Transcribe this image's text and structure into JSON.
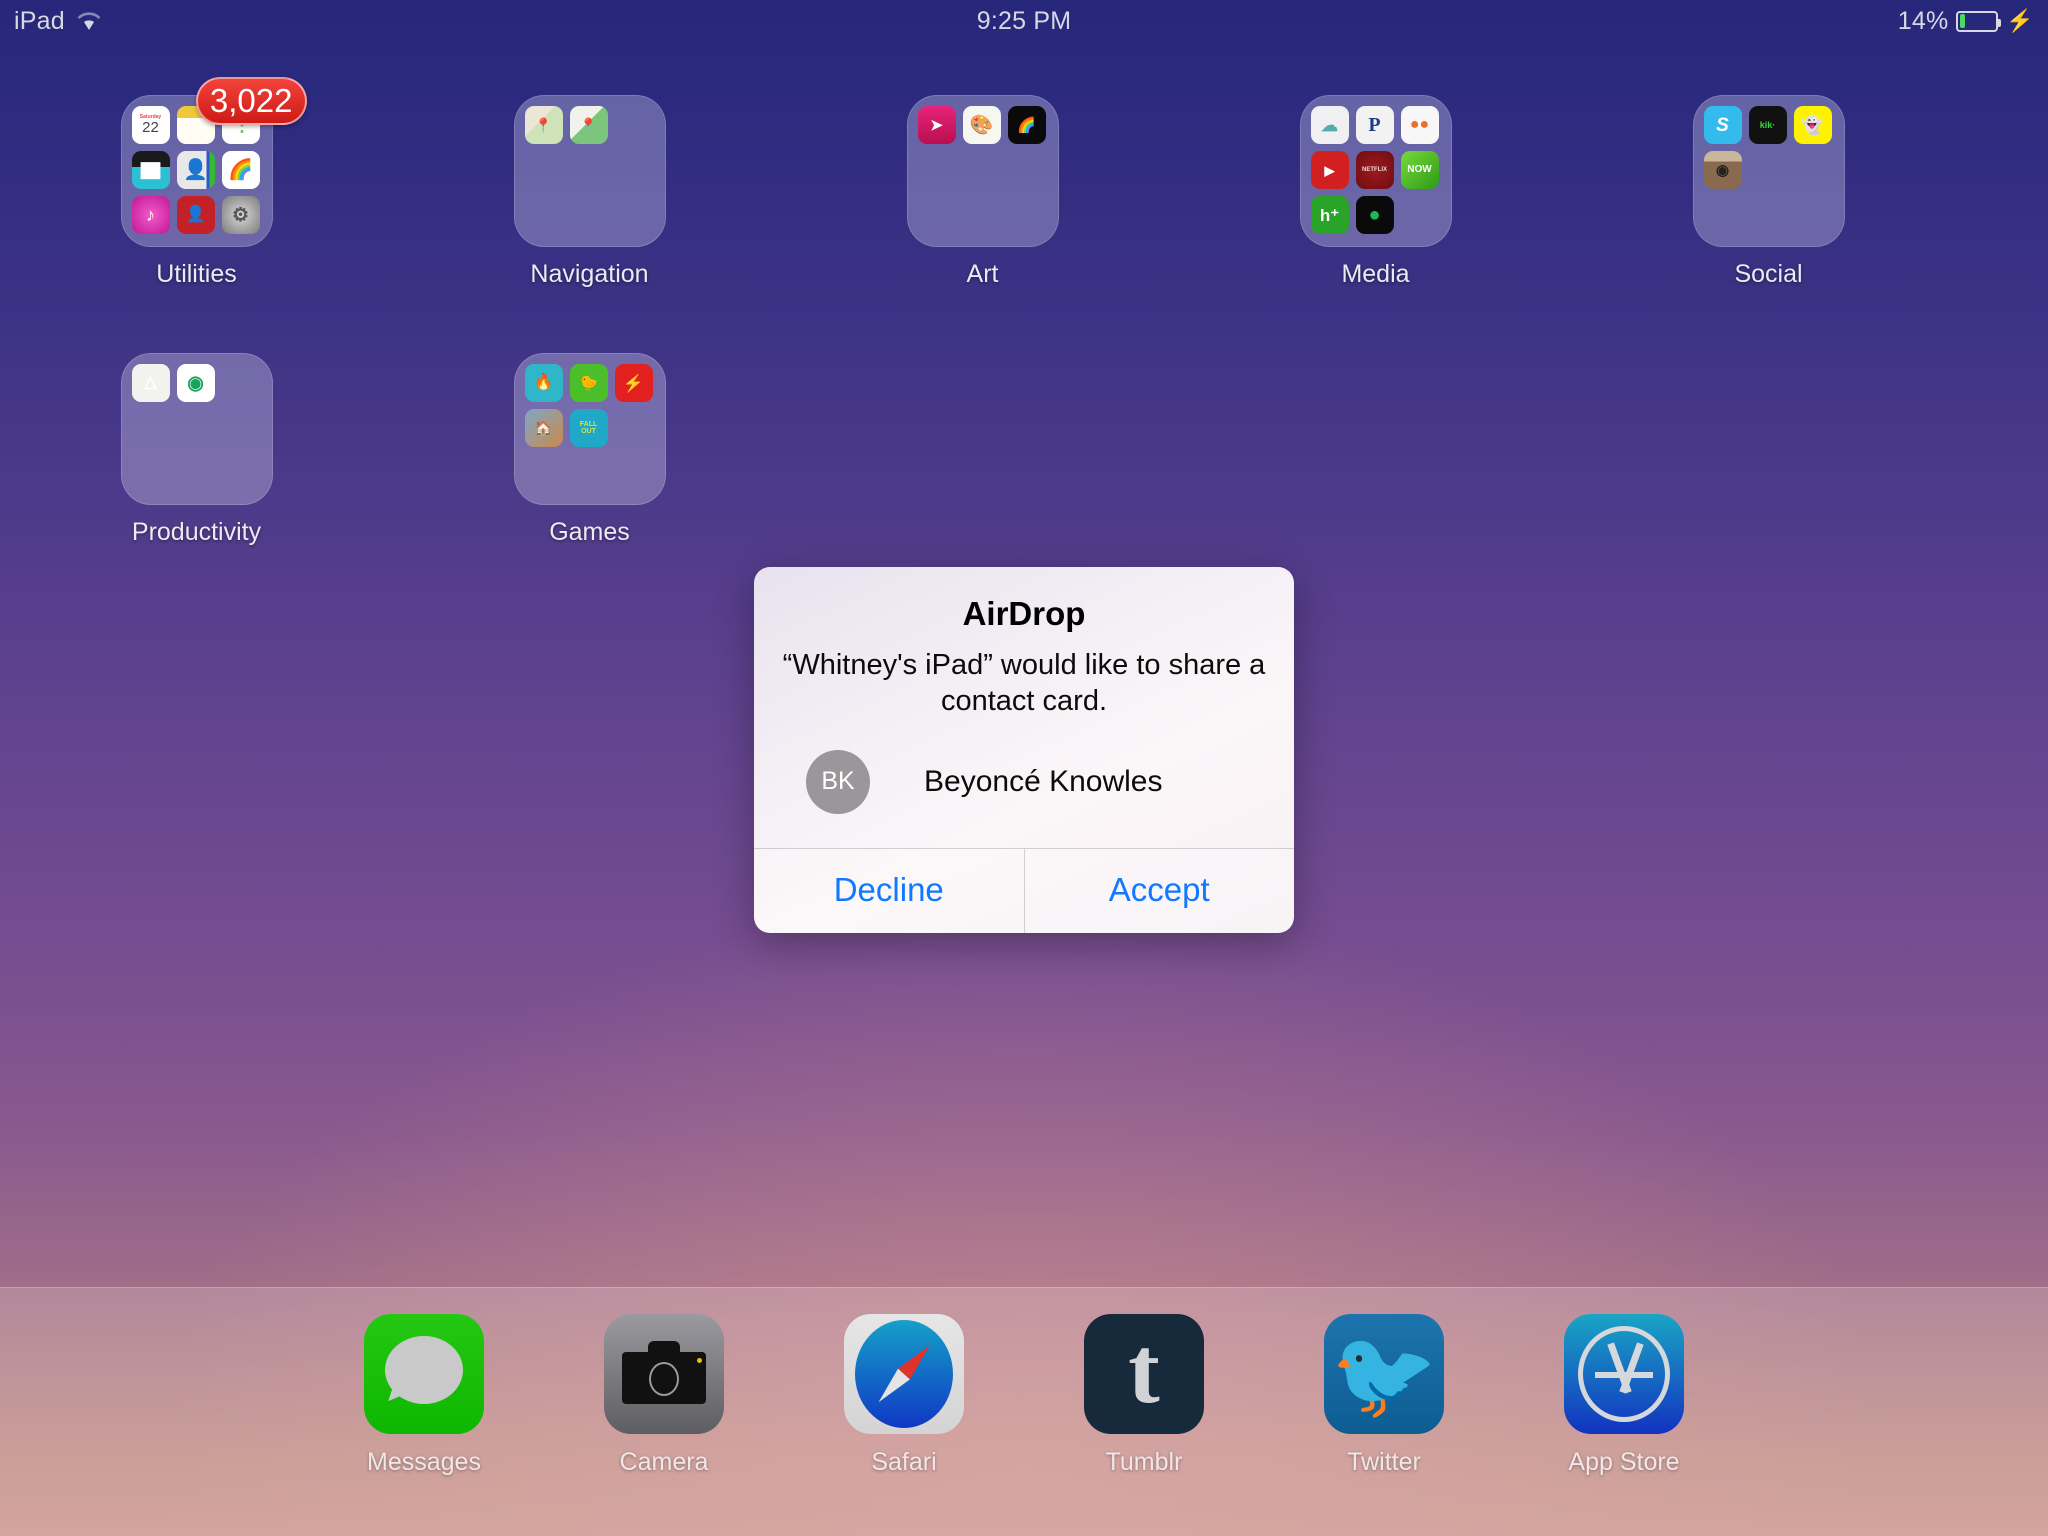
{
  "status_bar": {
    "device": "iPad",
    "wifi_icon": "wifi-icon",
    "time": "9:25 PM",
    "battery_percent": "14%",
    "battery_level": 14,
    "charging_icon": "lightning-bolt-icon"
  },
  "home_screen": {
    "folders": [
      {
        "name": "Utilities",
        "badge": "3,022",
        "apps": [
          {
            "name": "Calendar",
            "glyph": "22",
            "bg": "#ffffff",
            "fg": "#333",
            "sub": "Saturday"
          },
          {
            "name": "Notes",
            "glyph": "",
            "bg": "#fdf5e3",
            "fg": "#8a7a50",
            "style": "notes"
          },
          {
            "name": "Reminders",
            "glyph": "",
            "bg": "#ffffff",
            "fg": "#555",
            "style": "reminders"
          },
          {
            "name": "iMovie",
            "glyph": "",
            "bg": "#2bbccc",
            "fg": "#fff",
            "style": "imovie"
          },
          {
            "name": "Contacts",
            "glyph": "",
            "bg": "#ececec",
            "fg": "#888",
            "style": "contacts"
          },
          {
            "name": "Photos",
            "glyph": "",
            "bg": "#fbfbfb",
            "fg": "#fff",
            "style": "photos"
          },
          {
            "name": "iTunes Store",
            "glyph": "♪",
            "bg": "#e0209a",
            "fg": "#fff",
            "style": "itunes"
          },
          {
            "name": "Cards",
            "glyph": "",
            "bg": "#c42027",
            "fg": "#fff",
            "style": "cards"
          },
          {
            "name": "Settings",
            "glyph": "",
            "bg": "#8f8f8f",
            "fg": "#fff",
            "style": "settings"
          }
        ]
      },
      {
        "name": "Navigation",
        "badge": "",
        "apps": [
          {
            "name": "Maps",
            "glyph": "",
            "bg": "#ebe5d6",
            "fg": "#4a8",
            "style": "maps"
          },
          {
            "name": "Google Maps",
            "glyph": "",
            "bg": "#f1f1ec",
            "fg": "#4a8",
            "style": "gmaps"
          }
        ]
      },
      {
        "name": "Art",
        "badge": "",
        "apps": [
          {
            "name": "Paper",
            "glyph": "",
            "bg": "#d41a5e",
            "fg": "#fff",
            "style": "paper"
          },
          {
            "name": "Paint",
            "glyph": "",
            "bg": "#f6f6f2",
            "fg": "#333",
            "style": "paint"
          },
          {
            "name": "Procreate",
            "glyph": "",
            "bg": "#0b0b0b",
            "fg": "#fff",
            "style": "procreate"
          }
        ]
      },
      {
        "name": "Media",
        "badge": "",
        "apps": [
          {
            "name": "Podcasts",
            "glyph": "",
            "bg": "#f0f0f2",
            "fg": "#5a8",
            "style": "podcasts"
          },
          {
            "name": "Pandora",
            "glyph": "P",
            "bg": "#f2f2f2",
            "fg": "#1e3c87"
          },
          {
            "name": "TuneIn",
            "glyph": "",
            "bg": "#f7f7f7",
            "fg": "#e8722a",
            "style": "tunein"
          },
          {
            "name": "YouTube",
            "glyph": "▶",
            "bg": "#d22020",
            "fg": "#fff",
            "style": "youtube"
          },
          {
            "name": "Netflix",
            "glyph": "NETFLIX",
            "bg": "#8b1318",
            "fg": "#e8e0d8",
            "style": "netflix"
          },
          {
            "name": "NOW",
            "glyph": "NOW",
            "bg": "#4bbf2a",
            "fg": "#fff",
            "style": "now"
          },
          {
            "name": "Hulu Plus",
            "glyph": "h⁺",
            "bg": "#2aa329",
            "fg": "#fff"
          },
          {
            "name": "Spotify",
            "glyph": "",
            "bg": "#0a0a0a",
            "fg": "#1db954",
            "style": "spotify"
          }
        ]
      },
      {
        "name": "Social",
        "badge": "",
        "apps": [
          {
            "name": "Skype",
            "glyph": "S",
            "bg": "#33bbee",
            "fg": "#fff",
            "style": "skype"
          },
          {
            "name": "Kik",
            "glyph": "kik·",
            "bg": "#111",
            "fg": "#3bd63b",
            "style": "kik"
          },
          {
            "name": "Snapchat",
            "glyph": "👻",
            "bg": "#fff200",
            "fg": "#fff",
            "style": "snapchat"
          },
          {
            "name": "Instagram",
            "glyph": "",
            "bg": "#cbb89d",
            "fg": "#fff",
            "style": "instagram"
          }
        ]
      },
      {
        "name": "Productivity",
        "badge": "",
        "apps": [
          {
            "name": "Google Drive",
            "glyph": "",
            "bg": "#f2f2ee",
            "fg": "#333",
            "style": "drive"
          },
          {
            "name": "Timer",
            "glyph": "",
            "bg": "#16a45e",
            "fg": "#fff",
            "style": "timer"
          }
        ]
      },
      {
        "name": "Games",
        "badge": "",
        "apps": [
          {
            "name": "Blue Flame",
            "glyph": "",
            "bg": "#2fb7c9",
            "fg": "#fff",
            "style": "game1"
          },
          {
            "name": "Flappy Bird",
            "glyph": "",
            "bg": "#4bbf2a",
            "fg": "#fff",
            "style": "game2"
          },
          {
            "name": "Bolt",
            "glyph": "⚡",
            "bg": "#e22020",
            "fg": "#fff",
            "style": "game3"
          },
          {
            "name": "Adventure",
            "glyph": "",
            "bg": "#5a7b9c",
            "fg": "#fff",
            "style": "game4"
          },
          {
            "name": "Fall Out",
            "glyph": "FALL OUT",
            "bg": "#1fa8c8",
            "fg": "#d8e43a",
            "style": "game5"
          }
        ]
      }
    ],
    "dock": [
      {
        "label": "Messages",
        "icon": "messages-icon"
      },
      {
        "label": "Camera",
        "icon": "camera-icon"
      },
      {
        "label": "Safari",
        "icon": "safari-icon"
      },
      {
        "label": "Tumblr",
        "icon": "tumblr-icon",
        "glyph": "t"
      },
      {
        "label": "Twitter",
        "icon": "twitter-icon",
        "glyph": "🐦"
      },
      {
        "label": "App Store",
        "icon": "app-store-icon"
      }
    ]
  },
  "alert": {
    "title": "AirDrop",
    "message": "“Whitney's iPad” would like to share a contact card.",
    "contact": {
      "initials": "BK",
      "name": "Beyoncé Knowles"
    },
    "decline_label": "Decline",
    "accept_label": "Accept",
    "accent_color": "#1079ff"
  }
}
